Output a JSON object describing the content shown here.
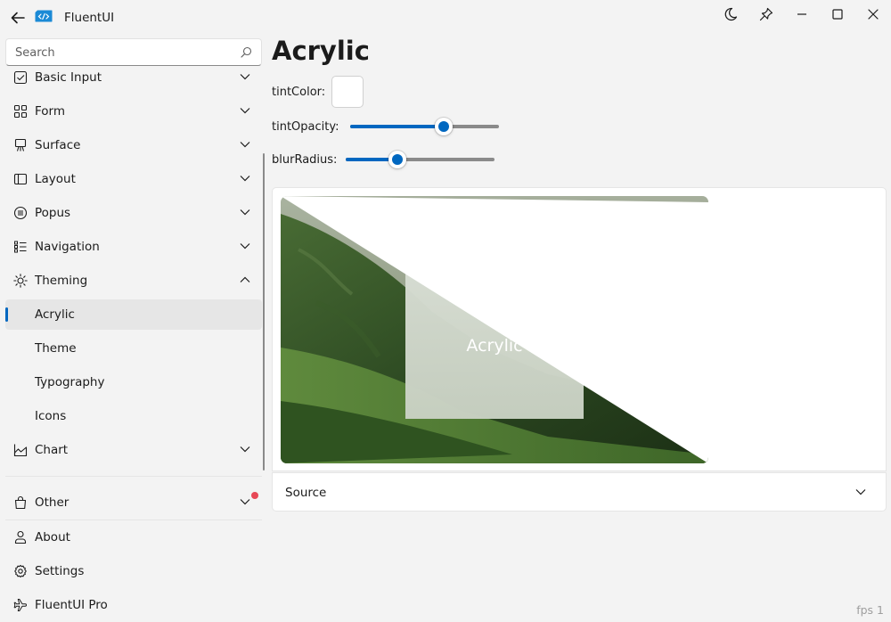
{
  "window": {
    "title": "FluentUI",
    "buttons": [
      "moon-icon",
      "pin-icon",
      "minimize-icon",
      "maximize-icon",
      "close-icon"
    ]
  },
  "search": {
    "placeholder": "Search",
    "value": ""
  },
  "nav": {
    "items": [
      {
        "label": "Basic Input",
        "icon": "checkbox-icon",
        "expanded": false
      },
      {
        "label": "Form",
        "icon": "grid-icon",
        "expanded": false
      },
      {
        "label": "Surface",
        "icon": "easel-icon",
        "expanded": false
      },
      {
        "label": "Layout",
        "icon": "panel-icon",
        "expanded": false
      },
      {
        "label": "Popus",
        "icon": "list-circle-icon",
        "expanded": false
      },
      {
        "label": "Navigation",
        "icon": "bullet-list-icon",
        "expanded": false
      },
      {
        "label": "Theming",
        "icon": "sun-icon",
        "expanded": true
      },
      {
        "label": "Acrylic",
        "child": true,
        "selected": true
      },
      {
        "label": "Theme",
        "child": true
      },
      {
        "label": "Typography",
        "child": true
      },
      {
        "label": "Icons",
        "child": true
      },
      {
        "label": "Chart",
        "icon": "area-chart-icon",
        "expanded": false
      }
    ],
    "other": {
      "label": "Other",
      "icon": "bag-icon"
    },
    "footer": [
      {
        "label": "About",
        "icon": "person-icon"
      },
      {
        "label": "Settings",
        "icon": "gear-icon"
      },
      {
        "label": "FluentUI Pro",
        "icon": "airplane-icon"
      }
    ]
  },
  "page": {
    "title": "Acrylic",
    "tint_color_label": "tintColor:",
    "tint_color_value": "#ffffff",
    "tint_opacity_label": "tintOpacity:",
    "tint_opacity": 0.63,
    "blur_radius_label": "blurRadius:",
    "blur_radius": 0.35,
    "demo_text": "Acrylic",
    "source_label": "Source"
  },
  "colors": {
    "accent": "#0067c0",
    "badge": "#e74856",
    "background": "#f3f3f3"
  },
  "status": {
    "fps": "fps 1"
  }
}
